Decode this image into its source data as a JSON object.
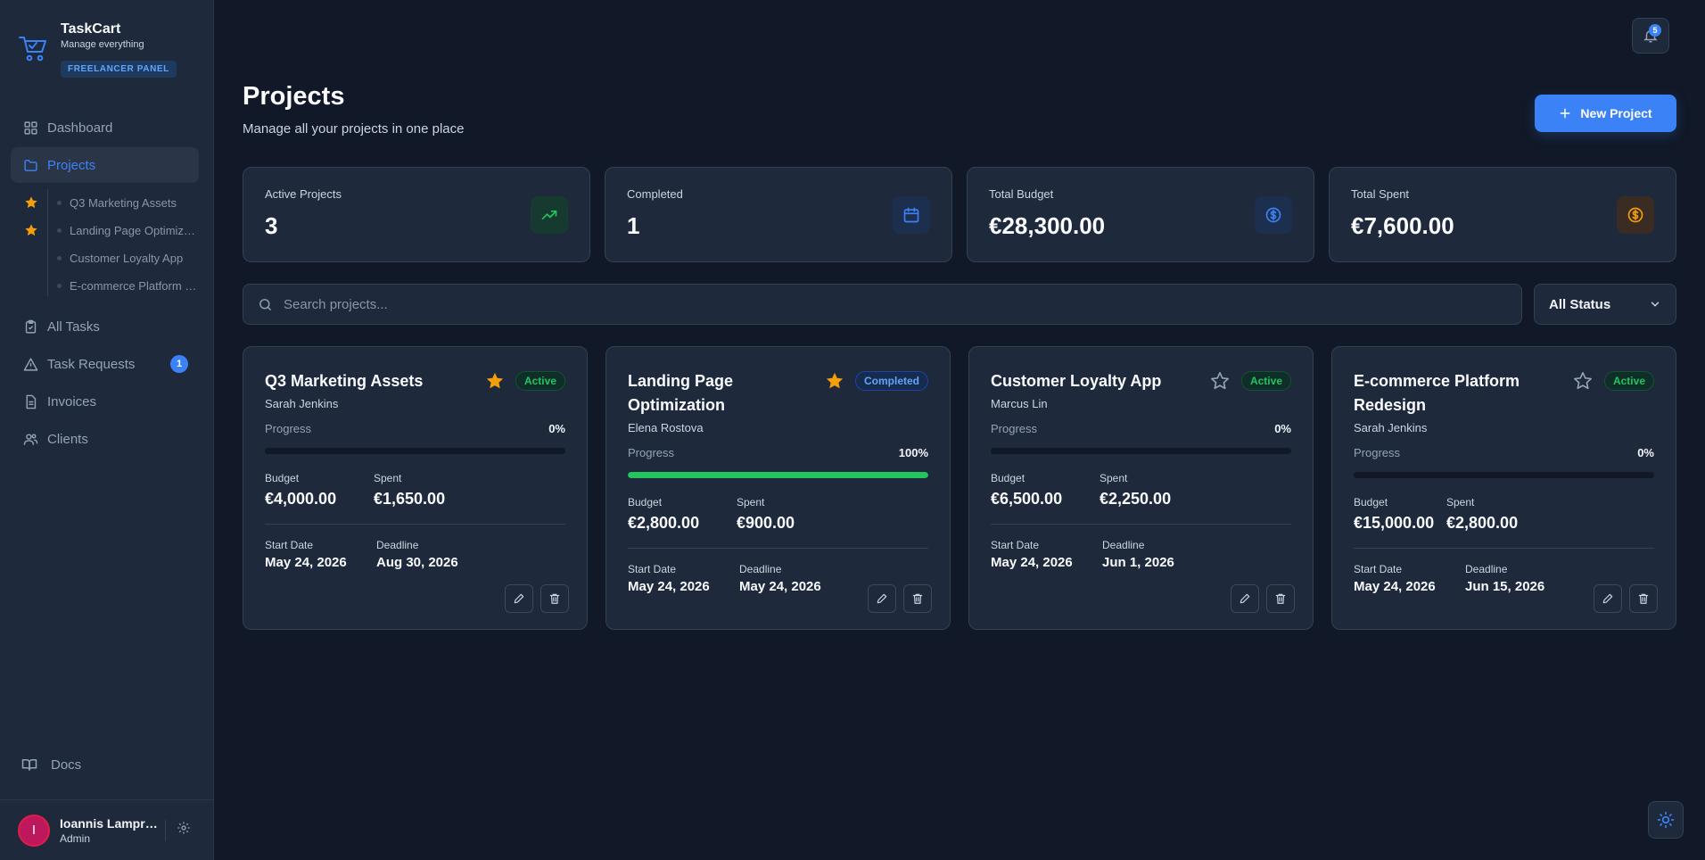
{
  "brand": {
    "name": "TaskCart",
    "tagline": "Manage everything",
    "badge": "FREELANCER PANEL"
  },
  "sidebar": {
    "nav": [
      {
        "label": "Dashboard",
        "icon": "grid-icon",
        "active": false
      },
      {
        "label": "Projects",
        "icon": "folder-icon",
        "active": true
      },
      {
        "label": "All Tasks",
        "icon": "clipboard-icon",
        "active": false
      },
      {
        "label": "Task Requests",
        "icon": "alert-triangle-icon",
        "active": false,
        "badge": "1"
      },
      {
        "label": "Invoices",
        "icon": "file-text-icon",
        "active": false
      },
      {
        "label": "Clients",
        "icon": "users-icon",
        "active": false
      }
    ],
    "project_links": [
      {
        "label": "Q3 Marketing Assets",
        "starred": true
      },
      {
        "label": "Landing Page Optimization",
        "starred": true
      },
      {
        "label": "Customer Loyalty App",
        "starred": false
      },
      {
        "label": "E-commerce Platform Redesign",
        "starred": false
      }
    ],
    "docs_label": "Docs",
    "user": {
      "initial": "I",
      "name": "Ioannis Lampropoulos",
      "role": "Admin"
    }
  },
  "header": {
    "notification_count": "5"
  },
  "page": {
    "title": "Projects",
    "subtitle": "Manage all your projects in one place",
    "new_button": "New Project"
  },
  "stats": [
    {
      "label": "Active Projects",
      "value": "3",
      "icon": "trending-up-icon",
      "color": "#22c55e"
    },
    {
      "label": "Completed",
      "value": "1",
      "icon": "calendar-icon",
      "color": "#3b82f6"
    },
    {
      "label": "Total Budget",
      "value": "€28,300.00",
      "icon": "dollar-circle-icon",
      "color": "#3b82f6"
    },
    {
      "label": "Total Spent",
      "value": "€7,600.00",
      "icon": "dollar-circle-icon",
      "color": "#f59e0b"
    }
  ],
  "search": {
    "placeholder": "Search projects..."
  },
  "status_filter": {
    "selected": "All Status"
  },
  "labels": {
    "progress": "Progress",
    "budget": "Budget",
    "spent": "Spent",
    "start_date": "Start Date",
    "deadline": "Deadline"
  },
  "projects": [
    {
      "title": "Q3 Marketing Assets",
      "client": "Sarah Jenkins",
      "status": "Active",
      "starred": true,
      "progress": 0,
      "progress_text": "0%",
      "budget": "€4,000.00",
      "spent": "€1,650.00",
      "start": "May 24, 2026",
      "deadline": "Aug 30, 2026"
    },
    {
      "title": "Landing Page Optimization",
      "client": "Elena Rostova",
      "status": "Completed",
      "starred": true,
      "progress": 100,
      "progress_text": "100%",
      "budget": "€2,800.00",
      "spent": "€900.00",
      "start": "May 24, 2026",
      "deadline": "May 24, 2026"
    },
    {
      "title": "Customer Loyalty App",
      "client": "Marcus Lin",
      "status": "Active",
      "starred": false,
      "progress": 0,
      "progress_text": "0%",
      "budget": "€6,500.00",
      "spent": "€2,250.00",
      "start": "May 24, 2026",
      "deadline": "Jun 1, 2026"
    },
    {
      "title": "E-commerce Platform Redesign",
      "client": "Sarah Jenkins",
      "status": "Active",
      "starred": false,
      "progress": 0,
      "progress_text": "0%",
      "budget": "€15,000.00",
      "spent": "€2,800.00",
      "start": "May 24, 2026",
      "deadline": "Jun 15, 2026"
    }
  ],
  "colors": {
    "accent": "#3b82f6",
    "success": "#22c55e",
    "star": "#f59e0b",
    "background": "#111827",
    "surface": "#1e293b"
  }
}
